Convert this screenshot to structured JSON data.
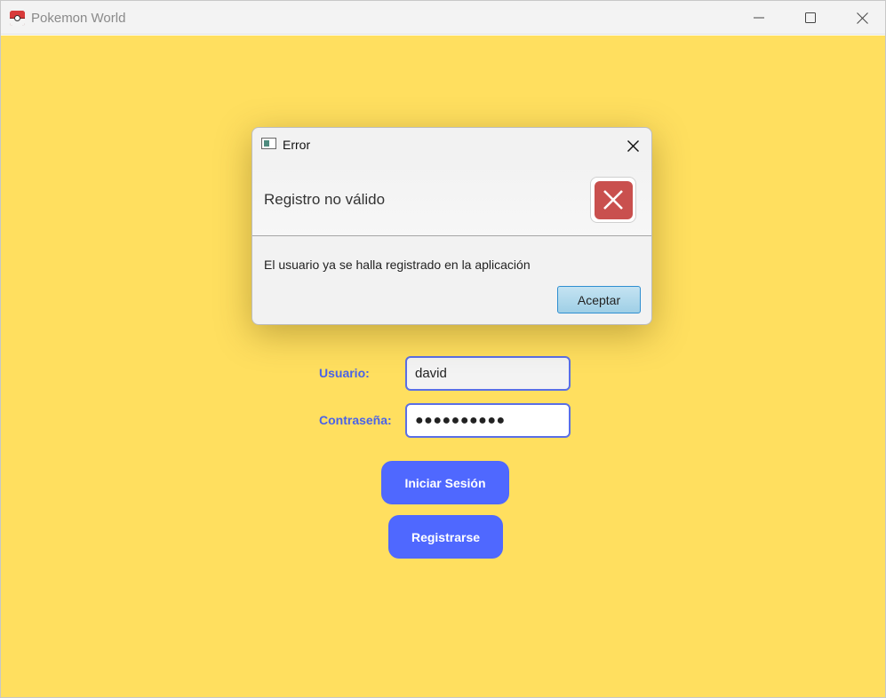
{
  "window": {
    "title": "Pokemon World",
    "icon": "pokeball-icon"
  },
  "login": {
    "username_label": "Usuario:",
    "username_value": "david",
    "password_label": "Contraseña:",
    "password_mask": "●●●●●●●●●●",
    "login_button": "Iniciar Sesión",
    "register_button": "Registrarse"
  },
  "dialog": {
    "title": "Error",
    "heading": "Registro no válido",
    "message": "El usuario ya se halla registrado en la aplicación",
    "ok_button": "Aceptar",
    "icon": "error-icon"
  },
  "colors": {
    "background": "#ffdf5f",
    "accent": "#4f68ff",
    "label": "#4a63e7",
    "error": "#c9504e"
  }
}
